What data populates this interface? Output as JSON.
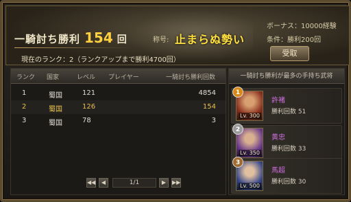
{
  "banner": {
    "title_prefix": "一騎討ち勝利",
    "title_count": "154",
    "title_unit": "回",
    "rank_text": "現在のランク：2（ランクアップまで勝利4700回）",
    "nickname_label": "称号:",
    "nickname_value": "止まらぬ勢い",
    "bonus_text": "ボーナス：10000経験",
    "condition_text": "条件：勝利200回",
    "receive_label": "受取"
  },
  "table": {
    "headers": [
      "ランク",
      "国家",
      "レベル",
      "プレイヤー",
      "一騎討ち勝利回数"
    ],
    "rows": [
      {
        "rank": "1",
        "country": "蜀国",
        "level": "121",
        "player": "",
        "wins": "4854"
      },
      {
        "rank": "2",
        "country": "蜀国",
        "level": "126",
        "player": "",
        "wins": "154"
      },
      {
        "rank": "3",
        "country": "蜀国",
        "level": "78",
        "player": "",
        "wins": "3"
      }
    ],
    "page": "1/1"
  },
  "side": {
    "header": "一騎討ち勝利が最多の手持ち武将",
    "generals": [
      {
        "medal": "1",
        "name": "許褚",
        "level": "Lv. 300",
        "wins": "勝利回数 51",
        "medal_color": "#d88a18",
        "portrait_color": "#8a3020"
      },
      {
        "medal": "2",
        "name": "黄忠",
        "level": "Lv. 350",
        "wins": "勝利回数 33",
        "medal_color": "#9a9a9a",
        "portrait_color": "#6a3a8a"
      },
      {
        "medal": "3",
        "name": "馬超",
        "level": "Lv. 500",
        "wins": "勝利回数 30",
        "medal_color": "#a06a30",
        "portrait_color": "#3a4a8a"
      }
    ]
  },
  "colors": {
    "accent_gold": "#ffd040",
    "highlight_row": "#e8c050",
    "general_name": "#d070e0"
  }
}
